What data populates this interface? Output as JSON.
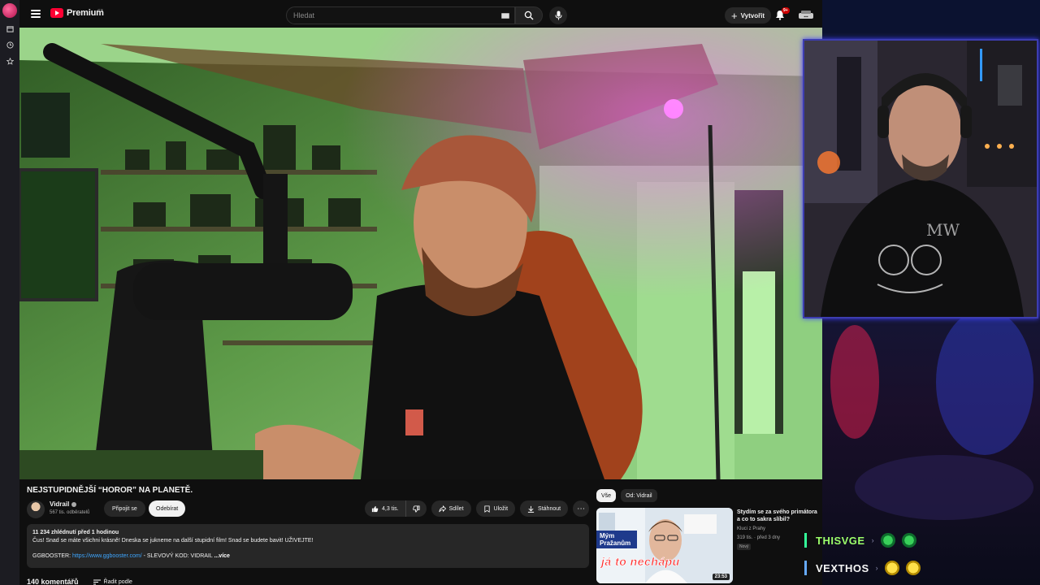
{
  "browser_sidebar": {
    "icons": [
      "app-logo",
      "bookmarks-icon",
      "history-icon",
      "star-icon"
    ]
  },
  "header": {
    "logo_text": "Premium",
    "logo_region": "CZ",
    "search_placeholder": "Hledat",
    "create_label": "Vytvořit",
    "notifications_badge": "9+"
  },
  "video": {
    "title": "NEJSTUPIDNĚJŠÍ “HOROR” NA PLANETĚ.",
    "channel": "Vidrail",
    "subscribers": "567 tis. odběratelů",
    "join_label": "Připojit se",
    "subscribe_label": "Odebírat",
    "likes": "4,3 tis.",
    "share_label": "Sdílet",
    "save_label": "Uložit",
    "download_label": "Stáhnout"
  },
  "description": {
    "stats": "11 234 zhlédnutí  před 1 hodinou",
    "line1": "Čus! Snad se máte všichni krásně! Dneska se jukneme na další stupidní film! Snad se budete bavit! UŽIVEJTE!",
    "promo_prefix": "GGBOOSTER: ",
    "promo_link": "https://www.ggbooster.com/",
    "promo_suffix": " - SLEVOVÝ KOD: VIDRAIL",
    "more_label": "...více"
  },
  "comments": {
    "count_label": "140 komentářů",
    "sort_label": "Řadit podle"
  },
  "sidebar_chips": [
    "Vše",
    "Od: Vidrail"
  ],
  "recommended": {
    "title": "Stydím se za svého primátora a co to sakra slíbil?",
    "channel": "Kluci z Prahy",
    "meta": "319 tis. · před 3 dny",
    "badge": "Nový",
    "duration": "23:53",
    "thumb_text_top": "Mým",
    "thumb_text_mid": "Pražanům",
    "thumb_text_bottom": "já to nechápu"
  },
  "chat": [
    {
      "name": "THISVGE",
      "color": "#9cff6a"
    },
    {
      "name": "VEXTHOS",
      "color": "#f5f5f5"
    }
  ],
  "colors": {
    "accent": "#ff0033",
    "link": "#3ea6ff",
    "frame": "#3d3db0"
  }
}
